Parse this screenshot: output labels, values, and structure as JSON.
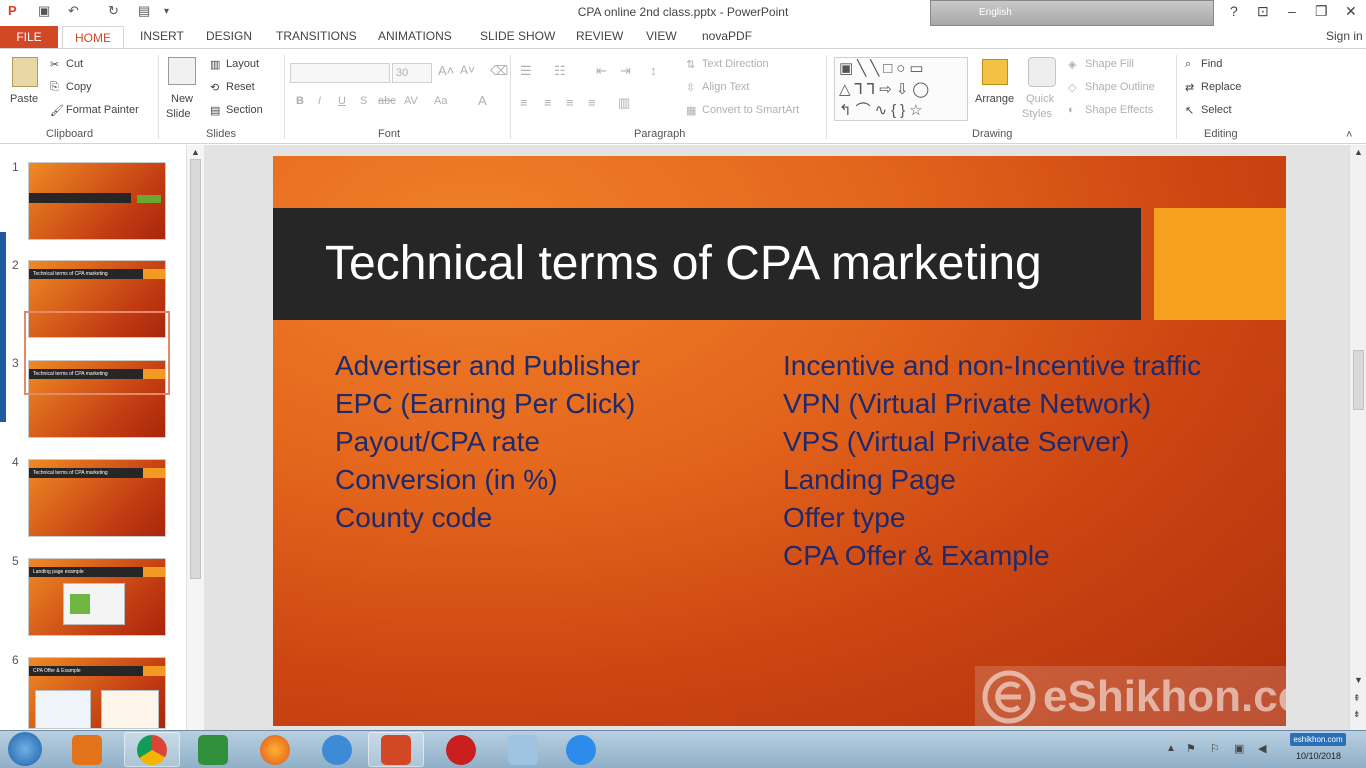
{
  "window": {
    "title": "CPA online 2nd class.pptx - PowerPoint",
    "sign_in": "Sign in",
    "lang_label": "English",
    "help": "?"
  },
  "tabs": [
    "FILE",
    "HOME",
    "INSERT",
    "DESIGN",
    "TRANSITIONS",
    "ANIMATIONS",
    "SLIDE SHOW",
    "REVIEW",
    "VIEW",
    "novaPDF"
  ],
  "ribbon": {
    "clipboard": {
      "paste": "Paste",
      "cut": "Cut",
      "copy": "Copy",
      "format_painter": "Format Painter",
      "label": "Clipboard"
    },
    "slides": {
      "new_slide_1": "New",
      "new_slide_2": "Slide",
      "layout": "Layout",
      "reset": "Reset",
      "section": "Section",
      "label": "Slides"
    },
    "font": {
      "size": "30",
      "label": "Font"
    },
    "paragraph": {
      "text_direction": "Text Direction",
      "align_text": "Align Text",
      "convert": "Convert to SmartArt",
      "label": "Paragraph"
    },
    "drawing": {
      "arrange": "Arrange",
      "quick_styles_1": "Quick",
      "quick_styles_2": "Styles",
      "shape_fill": "Shape Fill",
      "shape_outline": "Shape Outline",
      "shape_effects": "Shape Effects",
      "label": "Drawing"
    },
    "editing": {
      "find": "Find",
      "replace": "Replace",
      "select": "Select",
      "label": "Editing"
    }
  },
  "thumbnails": {
    "numbers": [
      "1",
      "2",
      "3",
      "4",
      "5",
      "6"
    ],
    "titles": [
      "Technical terms of CPA marketing",
      "Technical terms of CPA marketing",
      "Technical terms of CPA marketing",
      "Landing page example",
      "CPA Offer & Example"
    ],
    "selected": 4
  },
  "slide": {
    "title": "Technical terms of CPA marketing",
    "left_items": [
      "Advertiser and Publisher",
      "EPC (Earning Per Click)",
      "Payout/CPA rate",
      "Conversion (in %)",
      "County code"
    ],
    "right_items": [
      "Incentive and non-Incentive traffic",
      "VPN (Virtual Private Network)",
      "VPS (Virtual Private Server)",
      "Landing Page",
      "Offer type",
      "CPA Offer & Example"
    ],
    "watermark": "eShikhon.com"
  },
  "taskbar": {
    "date": "10/10/2018",
    "tray_badge": "eshikhon.com"
  }
}
